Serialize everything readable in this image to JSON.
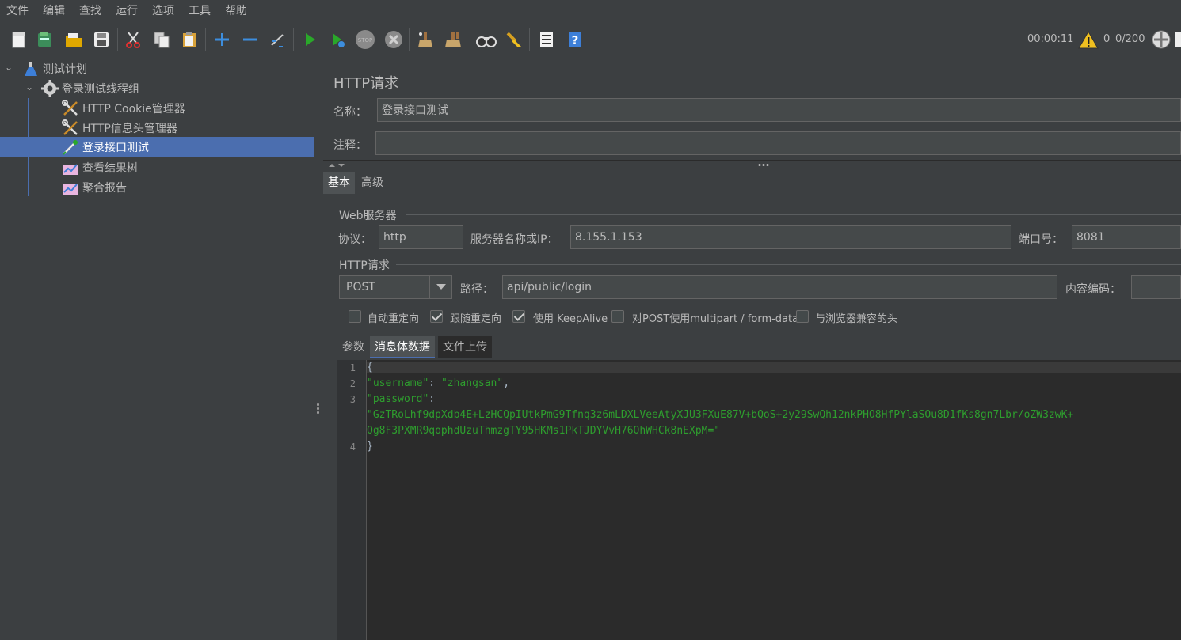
{
  "menu": [
    "文件",
    "编辑",
    "查找",
    "运行",
    "选项",
    "工具",
    "帮助"
  ],
  "toolbar": {
    "icons": [
      "new-icon",
      "templates-icon",
      "open-icon",
      "save-icon",
      "cut-icon",
      "copy-icon",
      "paste-icon",
      "expand-icon",
      "collapse-icon",
      "toggle-icon",
      "start-icon",
      "start-no-pause-icon",
      "stop-icon",
      "shutdown-icon",
      "clear-icon",
      "clear-all-icon",
      "search-icon",
      "reset-search-icon",
      "function-helper-icon",
      "help-icon"
    ],
    "timer": "00:00:11",
    "warnings": "0",
    "threads": "0/200"
  },
  "tree": {
    "items": [
      {
        "label": "测试计划",
        "icon": "test-plan-flask-icon"
      },
      {
        "label": "登录测试线程组",
        "icon": "thread-group-gear-icon"
      },
      {
        "label": "HTTP Cookie管理器",
        "icon": "config-wrench-icon"
      },
      {
        "label": "HTTP信息头管理器",
        "icon": "config-wrench-icon"
      },
      {
        "label": "登录接口测试",
        "icon": "sampler-pipette-icon"
      },
      {
        "label": "查看结果树",
        "icon": "listener-chart-icon"
      },
      {
        "label": "聚合报告",
        "icon": "listener-chart-icon"
      }
    ],
    "selected_index": 4
  },
  "panel": {
    "title": "HTTP请求",
    "name_label": "名称：",
    "name_value": "登录接口测试",
    "comment_label": "注释：",
    "comment_value": "",
    "tabs": [
      "基本",
      "高级"
    ],
    "web_server_title": "Web服务器",
    "protocol_label": "协议：",
    "protocol_value": "http",
    "server_label": "服务器名称或IP：",
    "server_value": "8.155.1.153",
    "port_label": "端口号：",
    "port_value": "8081",
    "http_request_title": "HTTP请求",
    "method_value": "POST",
    "path_label": "路径：",
    "path_value": "api/public/login",
    "encoding_label": "内容编码：",
    "encoding_value": "",
    "checkboxes": [
      {
        "label": "自动重定向",
        "checked": false
      },
      {
        "label": "跟随重定向",
        "checked": true
      },
      {
        "label": "使用 KeepAlive",
        "checked": true
      },
      {
        "label": "对POST使用multipart / form-data",
        "checked": false
      },
      {
        "label": "与浏览器兼容的头",
        "checked": false
      }
    ],
    "body_tabs": [
      "参数",
      "消息体数据",
      "文件上传"
    ],
    "body_tab_active": 1
  },
  "editor": {
    "line_numbers": [
      "1",
      "2",
      "3",
      "4"
    ],
    "line1": "{",
    "line2_key": "\"username\"",
    "line2_sep": ": ",
    "line2_val": "\"zhangsan\"",
    "line2_end": ",",
    "line3_key": "\"password\"",
    "line3_sep": ":",
    "line3_val_a": "\"GzTRoLhf9dpXdb4E+LzHCQpIUtkPmG9Tfnq3z6mLDXLVeeAtyXJU3FXuE87V+bQoS+2y29SwQh12nkPHO8HfPYlaSOu8D1fKs8gn7Lbr/oZW3zwK+",
    "line3_val_b": "Qg8F3PXMR9qophdUzuThmzgTY95HKMs1PkTJDYVvH76OhWHCk8nEXpM=\"",
    "line4": "}"
  }
}
